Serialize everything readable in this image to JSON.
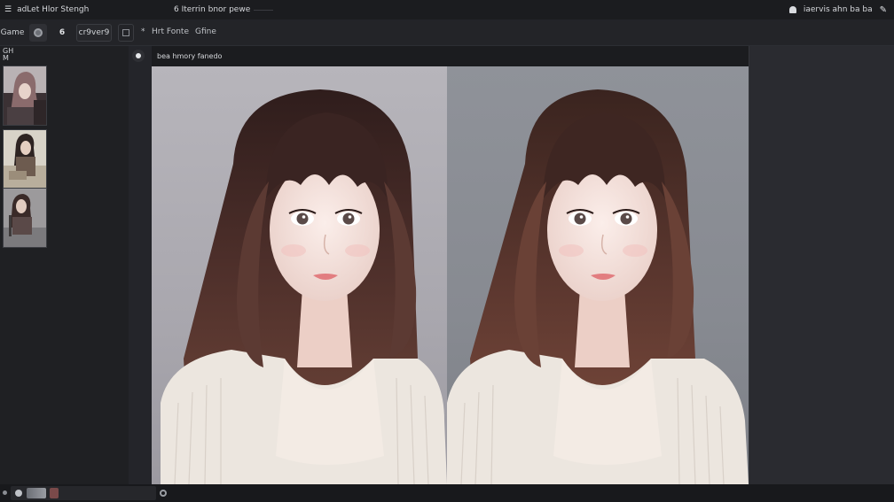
{
  "titlebar": {
    "app_icon": "app-logo-icon",
    "title": "adLet Hlor Stengh",
    "document_title": "6 Iterrin bnor pewe",
    "right_text": "iaervis ahn ba ba",
    "right_icon": "edit-icon"
  },
  "toolbar": {
    "game_label": "Game",
    "mode_label": "6",
    "dropdown_label": "cr9ver9",
    "menu_text": "Hrt Fonte",
    "menu_text_2": "Gfine",
    "star_marker": "*"
  },
  "sidebar": {
    "header": "GH\nM"
  },
  "canvas": {
    "header_label": "bea hmory fanedo"
  },
  "colors": {
    "background": "#1e1f22",
    "toolbar": "#232428",
    "panel_left_bg": "#b7b5bb",
    "panel_right_bg": "#8f9299",
    "hair": "#4a2f2a"
  }
}
